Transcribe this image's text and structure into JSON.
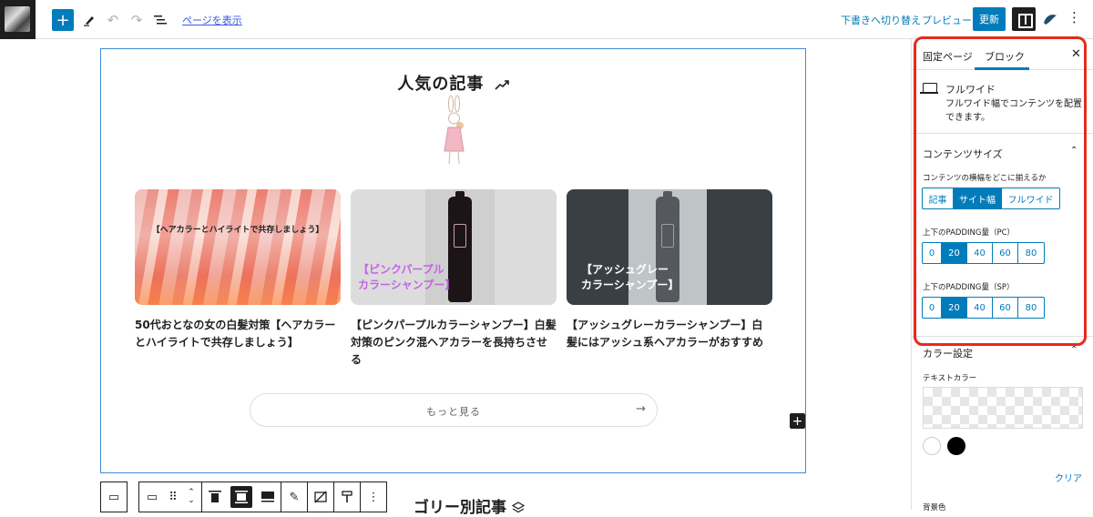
{
  "topbar": {
    "add_label": "+",
    "view_page": "ページを表示",
    "switch_to_draft": "下書きへ切り替え",
    "preview": "プレビュー",
    "update": "更新"
  },
  "editor": {
    "section_title": "人気の記事",
    "posts": [
      {
        "thumb_caption": "【ヘアカラーとハイライトで共存しましょう】",
        "title": "50代おとなの女の白髪対策【ヘアカラーとハイライトで共存しましょう】"
      },
      {
        "thumb_caption_line1": "【ピンクパープル",
        "thumb_caption_line2": "カラーシャンプー】",
        "title": "【ピンクパープルカラーシャンプー】白髪対策のピンク混ヘアカラーを長持ちさせる"
      },
      {
        "thumb_caption_line1": "【アッシュグレー",
        "thumb_caption_line2": "カラーシャンプー】",
        "title": "【アッシュグレーカラーシャンプー】白髪にはアッシュ系ヘアカラーがおすすめ"
      }
    ],
    "more_button": "もっと見る",
    "more_arrow": "→",
    "next_section_partial": "ゴリー別記事"
  },
  "sidebar": {
    "tabs": [
      "固定ページ",
      "ブロック"
    ],
    "block_name": "フルワイド",
    "block_description": "フルワイド幅でコンテンツを配置できます。",
    "content_size": {
      "heading": "コンテンツサイズ",
      "width_label": "コンテンツの横幅をどこに揃えるか",
      "width_options": [
        "記事",
        "サイト幅",
        "フルワイド"
      ],
      "width_selected": "サイト幅",
      "padding_pc_label": "上下のPADDING量（PC）",
      "padding_sp_label": "上下のPADDING量（SP）",
      "padding_options": [
        "0",
        "20",
        "40",
        "60",
        "80"
      ],
      "padding_pc_selected": "20",
      "padding_sp_selected": "20"
    },
    "color_settings": {
      "heading": "カラー設定",
      "text_color_label": "テキストカラー",
      "clear": "クリア",
      "background_label": "背景色"
    }
  },
  "colors": {
    "accent": "#007cba",
    "highlight": "#e8291c",
    "pink_caption": "#c564e6"
  }
}
